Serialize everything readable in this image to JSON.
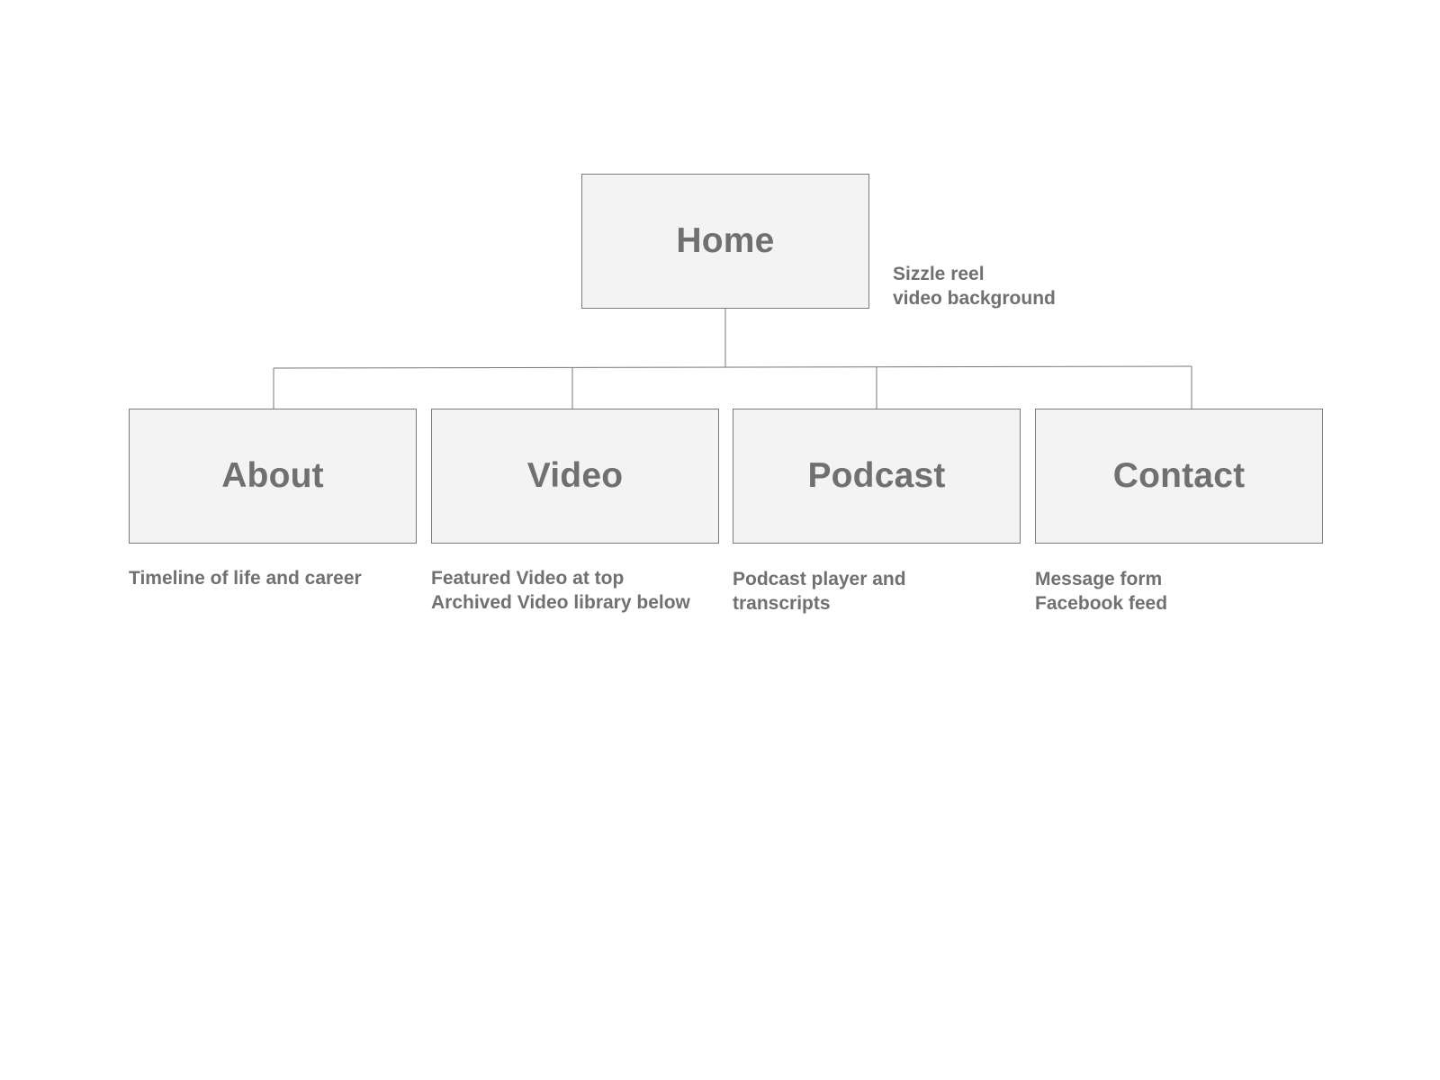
{
  "sitemap": {
    "root": {
      "label": "Home",
      "note": [
        "Sizzle reel",
        "video background"
      ]
    },
    "pages": [
      {
        "label": "About",
        "note": [
          "Timeline of life and career"
        ]
      },
      {
        "label": "Video",
        "note": [
          "Featured Video at top",
          "Archived Video library below"
        ]
      },
      {
        "label": "Podcast",
        "note": [
          "Podcast player and",
          "transcripts"
        ]
      },
      {
        "label": "Contact",
        "note": [
          "Message form",
          "Facebook feed"
        ]
      }
    ]
  }
}
